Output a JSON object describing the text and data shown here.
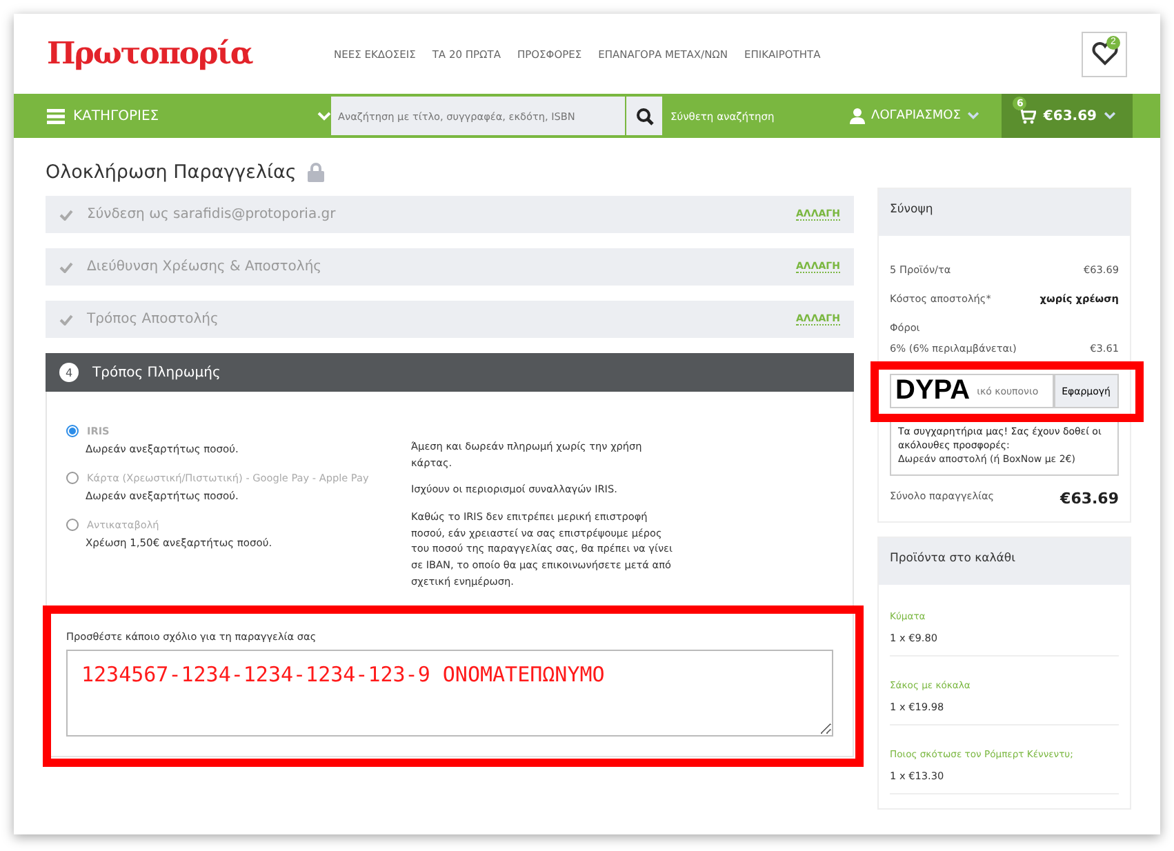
{
  "header": {
    "logo": "Πρωτοπορία",
    "nav": [
      "ΝΕΕΣ ΕΚΔΟΣΕΙΣ",
      "ΤΑ 20 ΠΡΩΤΑ",
      "ΠΡΟΣΦΟΡΕΣ",
      "ΕΠΑΝΑΓΟΡΑ ΜΕΤΑΧ/ΝΩΝ",
      "ΕΠΙΚΑΙΡΟΤΗΤΑ"
    ],
    "wishlist_count": "2"
  },
  "navbar": {
    "categories": "ΚΑΤΗΓΟΡΙΕΣ",
    "search": {
      "placeholder": "Αναζήτηση με τίτλο, συγγραφέα, εκδότη, ISBN"
    },
    "advanced_search": "Σύνθετη αναζήτηση",
    "account": "ΛΟΓΑΡΙΑΣΜΟΣ",
    "cart_count": "6",
    "cart_total": "€63.69"
  },
  "page_title": "Ολοκλήρωση Παραγγελίας",
  "steps": [
    {
      "label": "Σύνδεση ως sarafidis@protoporia.gr",
      "done": true,
      "action": "ΑΛΛΑΓΗ"
    },
    {
      "label": "Διεύθυνση Χρέωσης & Αποστολής",
      "done": true,
      "action": "ΑΛΛΑΓΗ"
    },
    {
      "label": "Τρόπος Αποστολής",
      "done": true,
      "action": "ΑΛΛΑΓΗ"
    },
    {
      "label": "Τρόπος Πληρωμής",
      "done": false,
      "number": "4"
    }
  ],
  "payment_options": [
    {
      "label": "IRIS",
      "note": "Δωρεάν ανεξαρτήτως ποσού.",
      "selected": true
    },
    {
      "label": "Κάρτα (Χρεωστική/Πιστωτική) - Google  Pay - Apple  Pay",
      "note": "Δωρεάν ανεξαρτήτως ποσού.",
      "selected": false
    },
    {
      "label": "Αντικαταβολή",
      "note": "Χρέωση 1,50€ ανεξαρτήτως ποσού.",
      "selected": false
    }
  ],
  "payment_info": [
    "Άμεση και δωρεάν πληρωμή χωρίς την χρήση κάρτας.",
    "Ισχύουν οι περιορισμοί συναλλαγών IRIS.",
    "Καθώς το IRIS δεν επιτρέπει μερική επιστροφή ποσού, εάν χρειαστεί να σας επιστρέψουμε μέρος του ποσού της παραγγελίας σας, θα πρέπει να γίνει σε IBAN, το οποίο θα μας επικοινωνήσετε μετά από σχετική ενημέρωση."
  ],
  "comment": {
    "label": "Προσθέστε κάποιο σχόλιο για τη παραγγελία σας",
    "value": "1234567-1234-1234-1234-123-9 ΟΝΟΜΑΤΕΠΩΝΥΜΟ"
  },
  "summary": {
    "title": "Σύνοψη",
    "rows": [
      {
        "label": "5 Προϊόν/τα",
        "value": "€63.69",
        "strong": false
      },
      {
        "label": "Κόστος αποστολής*",
        "value": "χωρίς χρέωση",
        "strong": true
      }
    ],
    "tax_label": "Φόροι",
    "tax_detail": "6% (6% περιλαμβάνεται)",
    "tax_value": "€3.61",
    "coupon": {
      "placeholder": "ικό κουπονιο",
      "button": "Εφαρμογή"
    },
    "offer": "Τα συγχαρητήρια μας! Σας έχουν δοθεί οι ακόλουθες προσφορές:",
    "offer_item": "Δωρεάν αποστολή (ή BoxNow με 2€)",
    "total_label": "Σύνολο παραγγελίας",
    "total_value": "€63.69"
  },
  "cart": {
    "title": "Προϊόντα στο καλάθι",
    "items": [
      {
        "name": "Κύματα",
        "qty": "1 x €9.80"
      },
      {
        "name": "Σάκος με κόκαλα",
        "qty": "1 x €19.98"
      },
      {
        "name": "Ποιος σκότωσε τον Ρόμπερτ Κέννεντυ;",
        "qty": "1 x €13.30"
      }
    ]
  },
  "annotation": {
    "text": "DYPA"
  }
}
